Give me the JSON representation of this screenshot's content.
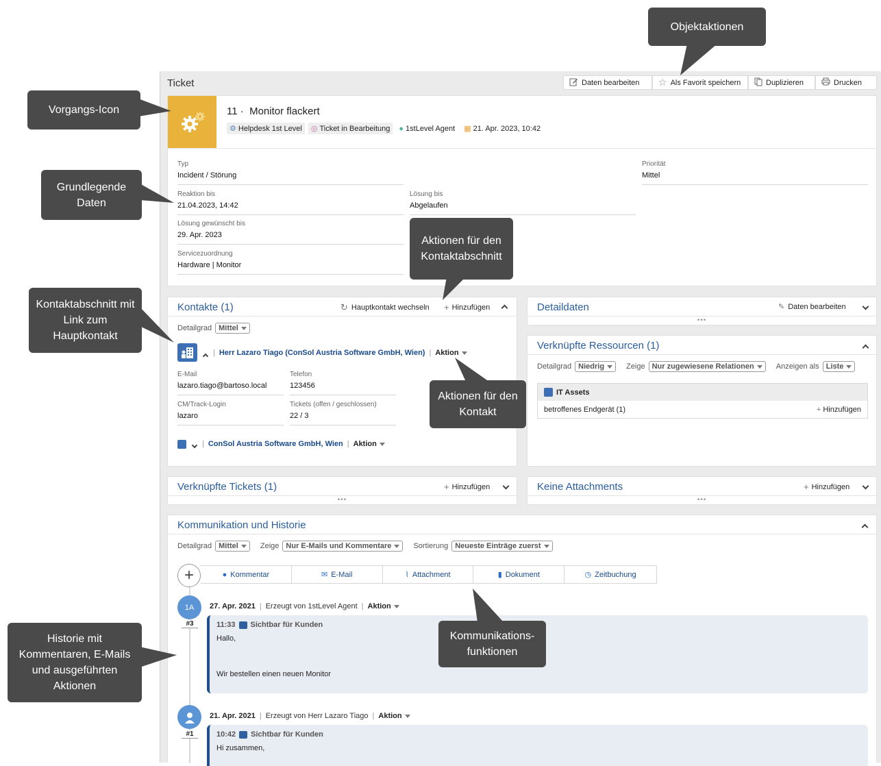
{
  "toolbar": {
    "title": "Ticket",
    "edit": "Daten bearbeiten",
    "favorite": "Als Favorit speichern",
    "duplicate": "Duplizieren",
    "print": "Drucken"
  },
  "ticket": {
    "number": "11 ·",
    "name": "Monitor flackert",
    "queue": "Helpdesk 1st Level",
    "status": "Ticket in Bearbeitung",
    "agent": "1stLevel Agent",
    "date": "21. Apr. 2023, 10:42",
    "accent_color": "#e9b23a"
  },
  "fields": {
    "typ_label": "Typ",
    "typ": "Incident / Störung",
    "prio_label": "Priorität",
    "prio": "Mittel",
    "reaktion_label": "Reaktion bis",
    "reaktion": "21.04.2023, 14:42",
    "loesung_label": "Lösung bis",
    "loesung": "Abgelaufen",
    "gewuenscht_label": "Lösung gewünscht bis",
    "gewuenscht": "29. Apr. 2023",
    "service_label": "Servicezuordnung",
    "service": "Hardware | Monitor"
  },
  "contacts": {
    "title": "Kontakte (1)",
    "switch": "Hauptkontakt wechseln",
    "add": "Hinzufügen",
    "detail_label": "Detailgrad",
    "detail_value": "Mittel",
    "person": "Herr Lazaro Tiago (ConSol Austria Software GmbH, Wien)",
    "action": "Aktion",
    "email_label": "E-Mail",
    "email": "lazaro.tiago@bartoso.local",
    "phone_label": "Telefon",
    "phone": "123456",
    "login_label": "CM/Track-Login",
    "login": "lazaro",
    "tickets_label": "Tickets (offen / geschlossen)",
    "tickets": "22 / 3",
    "company": "ConSol Austria Software GmbH, Wien",
    "company_action": "Aktion"
  },
  "detaildata": {
    "title": "Detaildaten",
    "edit": "Daten bearbeiten"
  },
  "resources": {
    "title": "Verknüpfte Ressourcen (1)",
    "detail_label": "Detailgrad",
    "detail_value": "Niedrig",
    "show_label": "Zeige",
    "show_value": "Nur zugewiesene Relationen",
    "display_label": "Anzeigen als",
    "display_value": "Liste",
    "group": "IT Assets",
    "item": "betroffenes Endgerät (1)",
    "add": "Hinzufügen"
  },
  "linked_tickets": {
    "title": "Verknüpfte Tickets (1)",
    "add": "Hinzufügen"
  },
  "attachments": {
    "title": "Keine Attachments",
    "add": "Hinzufügen"
  },
  "history": {
    "title": "Kommunikation und Historie",
    "detail_label": "Detailgrad",
    "detail_value": "Mittel",
    "show_label": "Zeige",
    "show_value": "Nur E-Mails und Kommentare",
    "sort_label": "Sortierung",
    "sort_value": "Neueste Einträge zuerst",
    "buttons": [
      "Kommentar",
      "E-Mail",
      "Attachment",
      "Dokument",
      "Zeitbuchung"
    ],
    "entries": [
      {
        "avatar": "1A",
        "num": "#3",
        "date": "27. Apr. 2021",
        "by": "Erzeugt von 1stLevel Agent",
        "action": "Aktion",
        "time": "11:33",
        "visibility": "Sichtbar für Kunden",
        "line1": "Hallo,",
        "line2": "Wir bestellen einen neuen Monitor"
      },
      {
        "avatar": "",
        "num": "#1",
        "date": "21. Apr. 2021",
        "by": "Erzeugt von Herr Lazaro Tiago",
        "action": "Aktion",
        "time": "10:42",
        "visibility": "Sichtbar für Kunden",
        "line1": "Hi zusammen,",
        "line2": ""
      }
    ]
  },
  "callouts": {
    "objektaktionen": "Objektaktionen",
    "vorgangsicon": "Vorgangs-Icon",
    "grunddaten": "Grundlegende Daten",
    "aktionen_kontaktabschnitt": "Aktionen für den Kontaktabschnitt",
    "kontaktabschnitt": "Kontaktabschnitt mit Link zum Hauptkontakt",
    "aktionen_kontakt": "Aktionen für den Kontakt",
    "kommunikation": "Kommunikations-funktionen",
    "historie": "Historie mit Kommentaren, E-Mails und ausgeführten Aktionen"
  }
}
